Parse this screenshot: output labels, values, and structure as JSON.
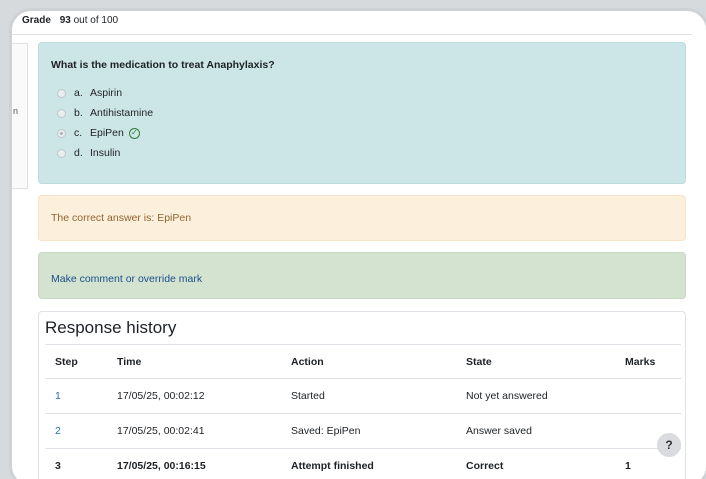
{
  "grade": {
    "label": "Grade",
    "value": "93",
    "suffix": "out of 100"
  },
  "side": {
    "mark": "n"
  },
  "question": {
    "text": "What is the medication to treat Anaphylaxis?",
    "options": [
      {
        "letter": "a.",
        "label": "Aspirin",
        "selected": false
      },
      {
        "letter": "b.",
        "label": "Antihistamine",
        "selected": false
      },
      {
        "letter": "c.",
        "label": "EpiPen",
        "selected": true,
        "correct_icon": "check-circle-icon"
      },
      {
        "letter": "d.",
        "label": "Insulin",
        "selected": false
      }
    ]
  },
  "feedback": {
    "text": "The correct answer is: EpiPen"
  },
  "comment": {
    "link": "Make comment or override mark"
  },
  "history": {
    "title": "Response history",
    "columns": [
      "Step",
      "Time",
      "Action",
      "State",
      "Marks"
    ],
    "rows": [
      {
        "step": "1",
        "time": "17/05/25, 00:02:12",
        "action": "Started",
        "state": "Not yet answered",
        "marks": ""
      },
      {
        "step": "2",
        "time": "17/05/25, 00:02:41",
        "action": "Saved: EpiPen",
        "state": "Answer saved",
        "marks": ""
      },
      {
        "step": "3",
        "time": "17/05/25, 00:16:15",
        "action": "Attempt finished",
        "state": "Correct",
        "marks": "1"
      }
    ]
  },
  "help": {
    "label": "?"
  },
  "colors": {
    "question_bg": "#cce6e7",
    "feedback_bg": "#fcefdc",
    "comment_bg": "#d3e3d0",
    "correct": "#357a32",
    "link": "#1f6fb2"
  }
}
